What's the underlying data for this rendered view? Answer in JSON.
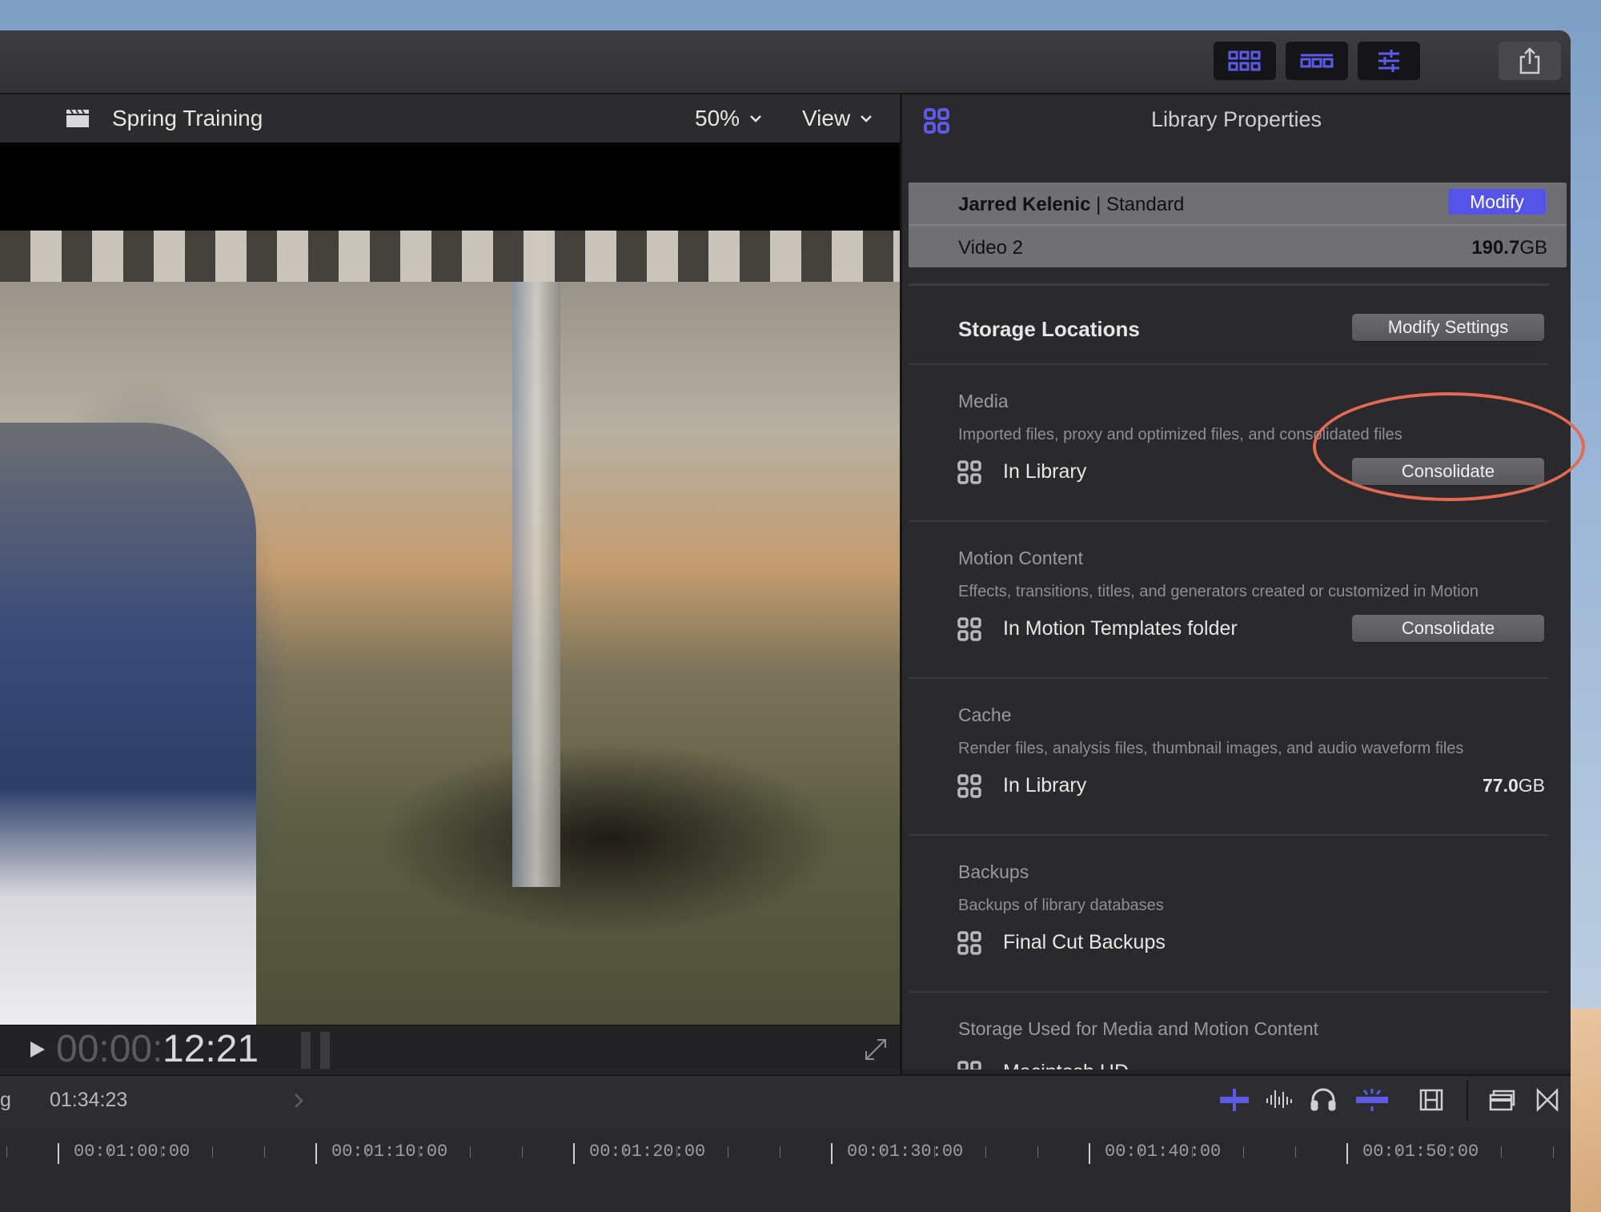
{
  "viewer": {
    "project_name": "Spring Training",
    "zoom": "50%",
    "view_label": "View",
    "timecode_dim": "00:00:",
    "timecode_bright": "12:21"
  },
  "inspector": {
    "title": "Library Properties",
    "owner_name": "Jarred Kelenic",
    "owner_separator": " | ",
    "owner_type": "Standard",
    "modify_label": "Modify",
    "library_name": "Video 2",
    "library_size_value": "190.7",
    "library_size_unit": "GB",
    "storage_title": "Storage Locations",
    "modify_settings_label": "Modify Settings",
    "sections": [
      {
        "title": "Media",
        "desc": "Imported files, proxy and optimized files, and consolidated files",
        "location": "In Library",
        "button": "Consolidate"
      },
      {
        "title": "Motion Content",
        "desc": "Effects, transitions, titles, and generators created or customized in Motion",
        "location": "In Motion Templates folder",
        "button": "Consolidate"
      },
      {
        "title": "Cache",
        "desc": "Render files, analysis files, thumbnail images, and audio waveform files",
        "location": "In Library",
        "size_value": "77.0",
        "size_unit": "GB"
      },
      {
        "title": "Backups",
        "desc": "Backups of library databases",
        "location": "Final Cut Backups"
      },
      {
        "title": "Storage Used for Media and Motion Content",
        "location": "Macintosh HD"
      }
    ]
  },
  "timeline": {
    "left_fragment": "g",
    "duration": "01:34:23",
    "ruler_labels": [
      "00:01:00:00",
      "00:01:10:00",
      "00:01:20:00",
      "00:01:30:00",
      "00:01:40:00",
      "00:01:50:00"
    ]
  },
  "colors": {
    "accent": "#5b5be8",
    "annotation": "#e36a55"
  }
}
